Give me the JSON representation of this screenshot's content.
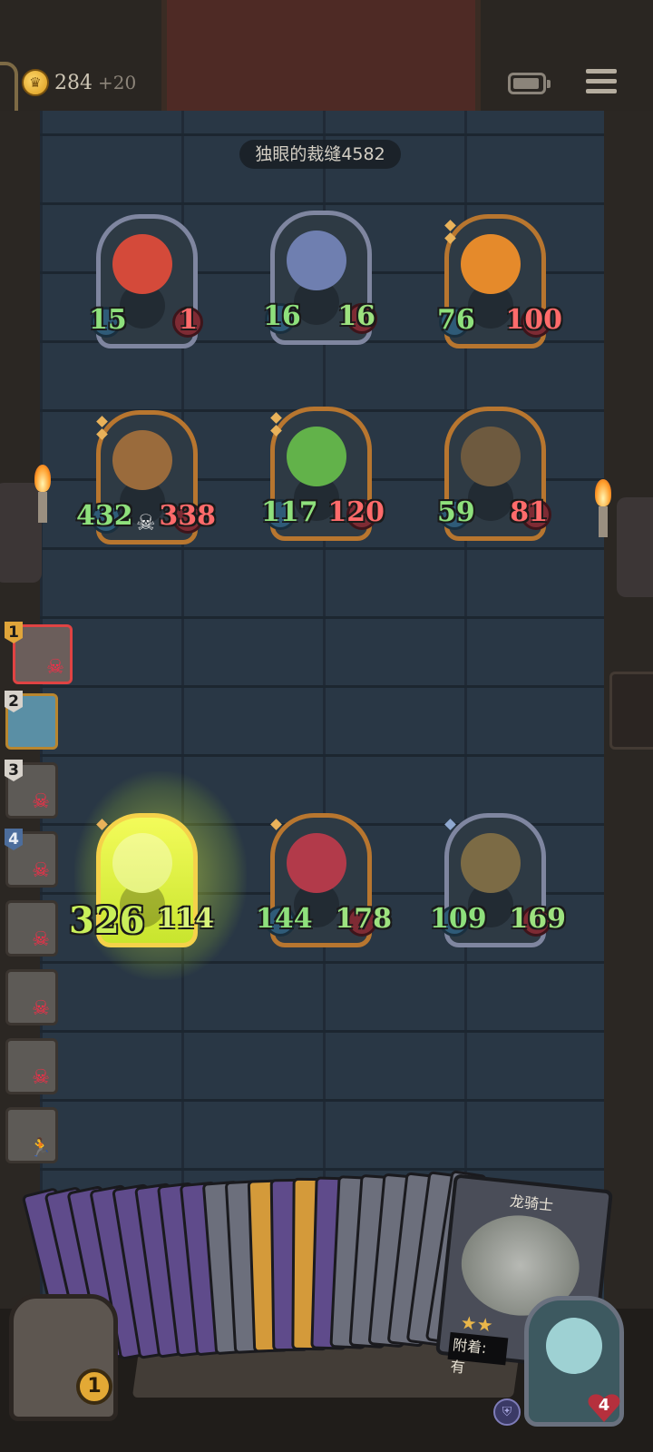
{
  "top_bar": {
    "gold": "284",
    "gold_bonus": "+20",
    "icons": [
      "crown-coin-icon",
      "battery-icon",
      "menu-icon"
    ]
  },
  "enemy_name": "独眼的裁缝4582",
  "board": {
    "enemy_row1": [
      {
        "name": "red-goblin",
        "atk": "15",
        "hp": "1"
      },
      {
        "name": "elf-sorceress",
        "atk": "16",
        "hp": "16"
      },
      {
        "name": "pumpkin-head",
        "atk": "76",
        "hp": "100"
      }
    ],
    "enemy_row2": [
      {
        "name": "bear",
        "atk": "432",
        "hp": "338"
      },
      {
        "name": "leaf-sprout",
        "atk": "117",
        "hp": "120"
      },
      {
        "name": "goblin-witch",
        "atk": "59",
        "hp": "81"
      }
    ],
    "player_row": [
      {
        "name": "knight-glowing",
        "atk": "326",
        "hp": "114"
      },
      {
        "name": "clown-jester",
        "atk": "144",
        "hp": "178"
      },
      {
        "name": "scarecrow-wizard",
        "atk": "109",
        "hp": "169"
      }
    ]
  },
  "turn_order": [
    {
      "no": "1",
      "status": "dead"
    },
    {
      "no": "2",
      "status": "ally"
    },
    {
      "no": "3",
      "status": "dead"
    },
    {
      "no": "4",
      "status": "dead"
    },
    {
      "no": "",
      "status": "dead"
    },
    {
      "no": "",
      "status": "dead"
    },
    {
      "no": "",
      "status": "dead"
    },
    {
      "no": "",
      "status": "fleeing"
    }
  ],
  "hand": {
    "featured_card_title": "龙骑士",
    "featured_card_desc": "附着:",
    "featured_card_desc2": "有"
  },
  "chest_count": "1",
  "hero_hp": "4",
  "colors": {
    "board": "#293745",
    "gold_frame": "#b8762f",
    "attack_green": "#8ee07c",
    "health_red": "#ff6b6b",
    "skull_red": "#ff2b47"
  }
}
